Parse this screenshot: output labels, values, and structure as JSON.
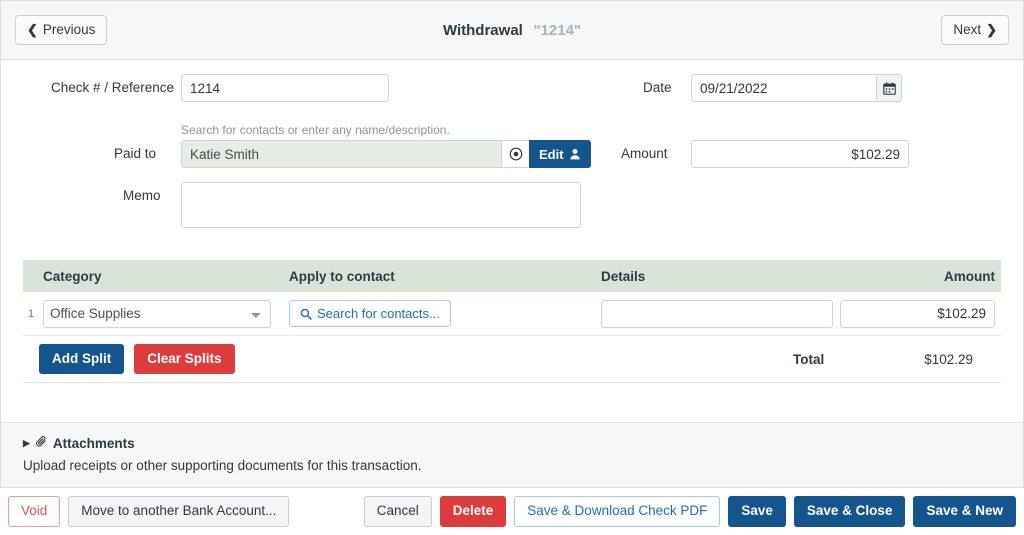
{
  "header": {
    "prev_label": "Previous",
    "next_label": "Next",
    "title": "Withdrawal",
    "reference": "\"1214\""
  },
  "form": {
    "check_label": "Check # / Reference",
    "check_value": "1214",
    "date_label": "Date",
    "date_value": "09/21/2022",
    "contacts_hint": "Search for contacts or enter any name/description.",
    "paid_to_label": "Paid to",
    "paid_to_value": "Katie Smith",
    "edit_label": "Edit",
    "amount_label": "Amount",
    "amount_value": "$102.29",
    "memo_label": "Memo",
    "memo_value": ""
  },
  "splits": {
    "columns": {
      "category": "Category",
      "apply_to_contact": "Apply to contact",
      "details": "Details",
      "amount": "Amount"
    },
    "rows": [
      {
        "index": "1",
        "category": "Office Supplies",
        "apply_to_contact": "Search for contacts...",
        "details": "",
        "amount": "$102.29"
      }
    ],
    "add_split_label": "Add Split",
    "clear_splits_label": "Clear Splits",
    "total_label": "Total",
    "total_value": "$102.29"
  },
  "attachments": {
    "title": "Attachments",
    "description": "Upload receipts or other supporting documents for this transaction."
  },
  "footer": {
    "void_label": "Void",
    "move_label": "Move to another Bank Account...",
    "cancel_label": "Cancel",
    "delete_label": "Delete",
    "save_download_label": "Save & Download Check PDF",
    "save_label": "Save",
    "save_close_label": "Save & Close",
    "save_new_label": "Save & New"
  },
  "colors": {
    "primary": "#15558d",
    "danger": "#dd3c3c",
    "table_header": "#d9e4d9",
    "paid_to_bg": "#e7ece7",
    "link": "#1f6fb2"
  }
}
